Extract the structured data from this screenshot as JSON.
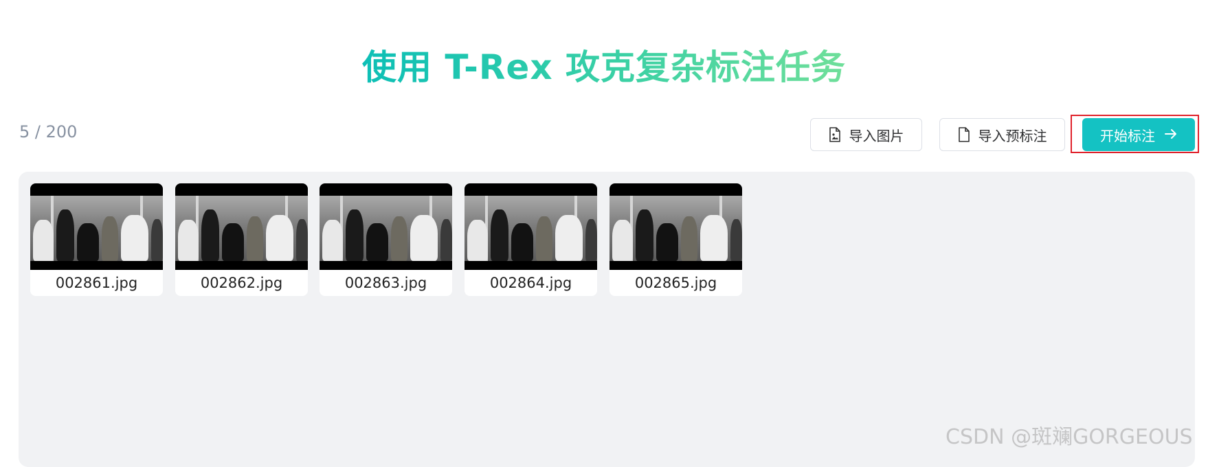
{
  "header": {
    "title": "使用 T-Rex 攻克复杂标注任务"
  },
  "toolbar": {
    "counter": "5 / 200",
    "import_images_label": "导入图片",
    "import_preannotations_label": "导入预标注",
    "start_label": "开始标注",
    "accent_color": "#14c2c3",
    "highlight_color": "#e0202a",
    "icons": {
      "import_images": "image-file-icon",
      "import_preannotations": "file-icon",
      "start": "arrow-right-icon"
    }
  },
  "gallery": {
    "images": [
      {
        "filename": "002861.jpg"
      },
      {
        "filename": "002862.jpg"
      },
      {
        "filename": "002863.jpg"
      },
      {
        "filename": "002864.jpg"
      },
      {
        "filename": "002865.jpg"
      }
    ]
  },
  "watermark": "CSDN @斑斓GORGEOUS"
}
